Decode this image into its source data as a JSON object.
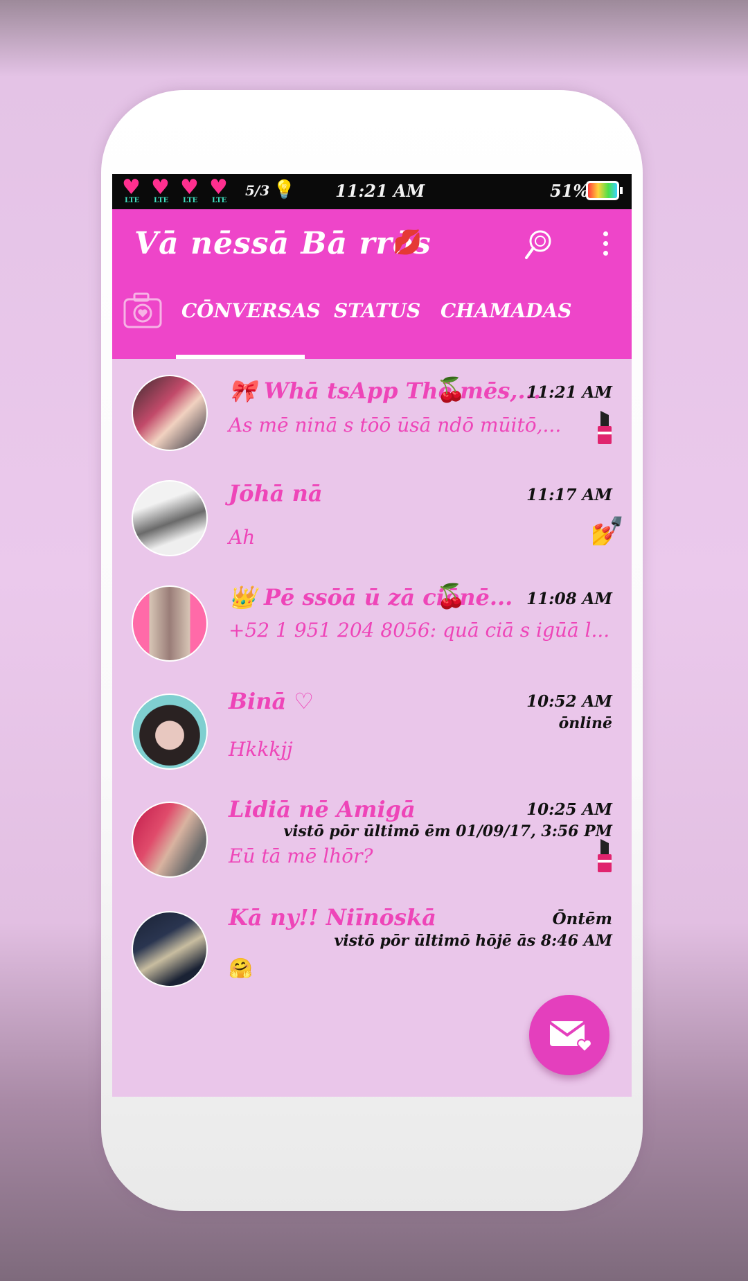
{
  "status_bar": {
    "lte_label": "LTE",
    "signal": "5/3",
    "time": "11:21 AM",
    "battery": "51%"
  },
  "app_bar": {
    "title": "Vā nēssā Bā rrōs",
    "search_icon": "search-icon",
    "menu_icon": "more-vert-icon"
  },
  "tabs": {
    "camera_icon": "camera-icon",
    "items": [
      "CŌNVERSAS",
      "STATUS",
      "CHAMADAS"
    ],
    "selected": "CŌNVERSAS"
  },
  "chats": [
    {
      "name": "🎀 Whā tsApp Thē mēs,...",
      "time": "11:21 AM",
      "message": "As mē ninā s tōō ūsā ndō mūitō,...",
      "icon": "lipstick-icon"
    },
    {
      "name": "Jōhā nā",
      "time": "11:17 AM",
      "message": "Ah",
      "icon": "nail-polish-icon"
    },
    {
      "name": "👑 Pē ssōā ū zā ciōnē...",
      "time": "11:08 AM",
      "message": "+52 1 951 204 8056: quā ciā s igūā l..."
    },
    {
      "name": "Binā ♡",
      "time": "10:52 AM",
      "status": "ōnlinē",
      "message": "Hkkkjj"
    },
    {
      "name": "Lidiā nē Amigā",
      "time": "10:25 AM",
      "status": "vistō pōr ūltimō ēm 01/09/17, 3:56 PM",
      "message": "Eū tā mē lhōr?",
      "icon": "lipstick-icon"
    },
    {
      "name": "Kā ny!! Niīnōskā",
      "time": "Ōntēm",
      "status": "vistō pōr ūltimō hōjē ās 8:46 AM",
      "message": "🤗"
    }
  ],
  "fab": {
    "icon": "new-message-heart-icon"
  },
  "colors": {
    "primary": "#ee45c9",
    "background": "#eac6ea",
    "accent_text": "#ee45b8",
    "status_bar": "#0a0a0a"
  }
}
